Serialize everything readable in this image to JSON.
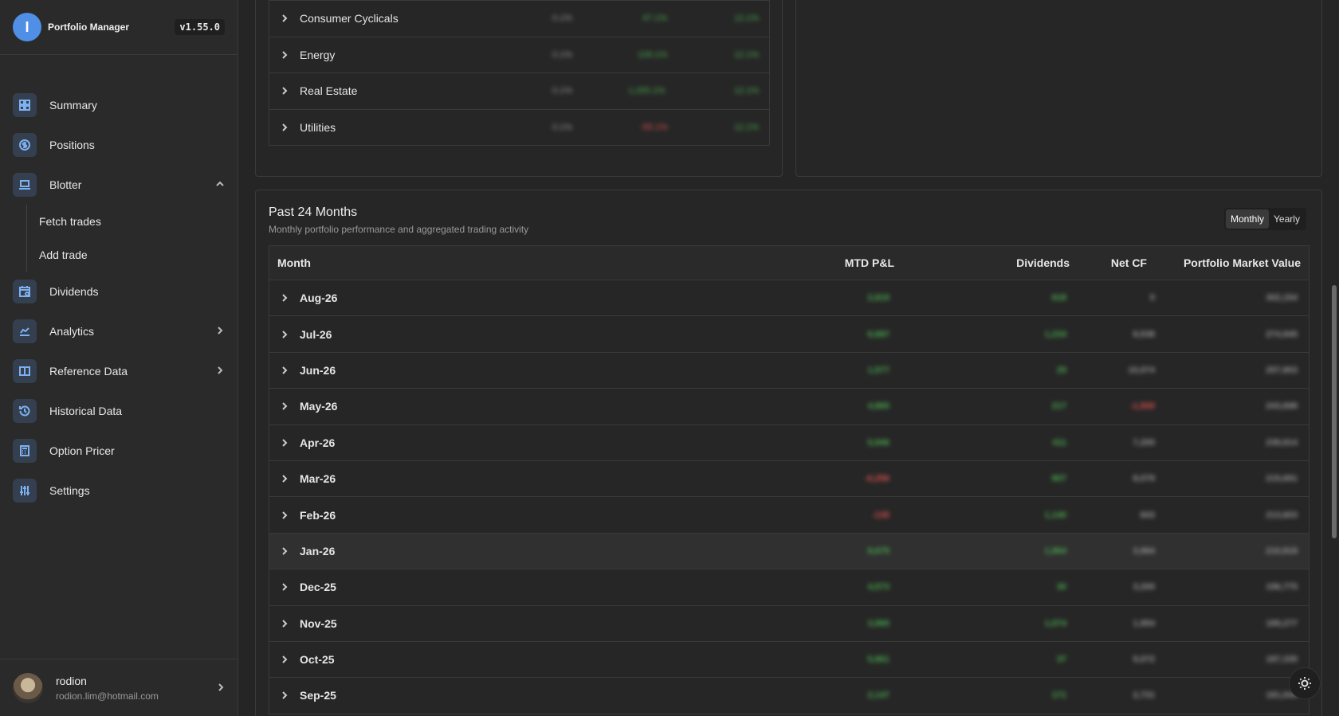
{
  "app": {
    "name": "Portfolio Manager",
    "version": "v1.55.0",
    "logo_glyph": "I"
  },
  "sidebar": {
    "items": [
      {
        "label": "Summary",
        "icon": "dashboard-icon"
      },
      {
        "label": "Positions",
        "icon": "dollar-icon"
      },
      {
        "label": "Blotter",
        "icon": "laptop-icon",
        "expanded": true
      },
      {
        "label": "Dividends",
        "icon": "calendar-icon"
      },
      {
        "label": "Analytics",
        "icon": "chart-icon"
      },
      {
        "label": "Reference Data",
        "icon": "book-icon"
      },
      {
        "label": "Historical Data",
        "icon": "history-icon"
      },
      {
        "label": "Option Pricer",
        "icon": "calculator-icon"
      },
      {
        "label": "Settings",
        "icon": "sliders-icon"
      }
    ],
    "blotter_sub": [
      "Fetch trades",
      "Add trade"
    ]
  },
  "user": {
    "name": "rodion",
    "email": "rodion.lim@hotmail.com"
  },
  "sectors": [
    {
      "name": "Consumer Cyclicals",
      "c1": "0.1%",
      "c2": "47.1%",
      "c3": "12.1%"
    },
    {
      "name": "Energy",
      "c1": "0.1%",
      "c2": "109.1%",
      "c3": "12.1%"
    },
    {
      "name": "Real Estate",
      "c1": "0.1%",
      "c2": "1,205.1%",
      "c3": "12.1%"
    },
    {
      "name": "Utilities",
      "c1": "0.1%",
      "c2": "-55.1%",
      "c3": "12.1%"
    }
  ],
  "performance": {
    "title": "Past 24 Months",
    "subtitle": "Monthly portfolio performance and aggregated trading activity",
    "toggle": {
      "monthly": "Monthly",
      "yearly": "Yearly"
    },
    "columns": {
      "month": "Month",
      "pnl": "MTD P&L",
      "div": "Dividends",
      "netcf": "Net CF",
      "mv": "Portfolio Market Value"
    },
    "rows": [
      {
        "month": "Aug-26",
        "pnl": "2,819",
        "div": "618",
        "netcf": "0",
        "mv": "302,154"
      },
      {
        "month": "Jul-26",
        "pnl": "6,687",
        "div": "1,234",
        "netcf": "8,538",
        "mv": "274,945"
      },
      {
        "month": "Jun-26",
        "pnl": "1,577",
        "div": "29",
        "netcf": "10,074",
        "mv": "257,803"
      },
      {
        "month": "May-26",
        "pnl": "4,865",
        "div": "217",
        "netcf": "-1,500",
        "mv": "243,698"
      },
      {
        "month": "Apr-26",
        "pnl": "5,946",
        "div": "411",
        "netcf": "7,200",
        "mv": "239,914"
      },
      {
        "month": "Mar-26",
        "pnl": "-6,256",
        "div": "807",
        "netcf": "8,079",
        "mv": "215,691"
      },
      {
        "month": "Feb-26",
        "pnl": "-135",
        "div": "1,140",
        "netcf": "843",
        "mv": "213,603"
      },
      {
        "month": "Jan-26",
        "pnl": "8,675",
        "div": "1,864",
        "netcf": "3,964",
        "mv": "210,818"
      },
      {
        "month": "Dec-25",
        "pnl": "4,573",
        "div": "30",
        "netcf": "3,200",
        "mv": "196,775"
      },
      {
        "month": "Nov-25",
        "pnl": "3,965",
        "div": "1,074",
        "netcf": "1,954",
        "mv": "189,277"
      },
      {
        "month": "Oct-25",
        "pnl": "5,861",
        "div": "37",
        "netcf": "9,072",
        "mv": "187,335"
      },
      {
        "month": "Sep-25",
        "pnl": "2,147",
        "div": "171",
        "netcf": "2,731",
        "mv": "181,044"
      }
    ],
    "highlighted_row": "Jan-26"
  },
  "colors": {
    "accent": "#4f8fe6",
    "positive": "#4caf50",
    "negative": "#e05252"
  }
}
